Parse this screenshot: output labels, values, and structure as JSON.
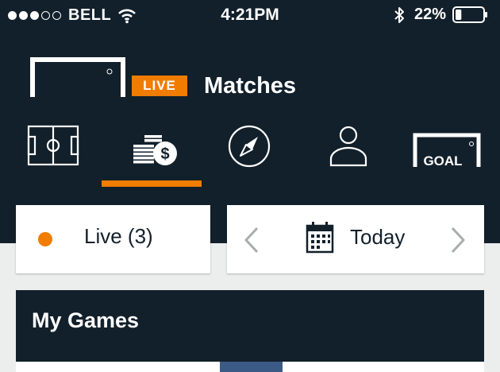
{
  "status_bar": {
    "carrier": "BELL",
    "time": "4:21PM",
    "battery_percent": "22%",
    "signal_bars_filled": 3,
    "signal_bars_total": 5,
    "battery_level": 0.22
  },
  "brand": {
    "live_badge": "LIVE",
    "title": "Matches",
    "logo_text": "GOAL"
  },
  "nav": {
    "items": [
      {
        "name": "pitch",
        "icon": "football-pitch-icon"
      },
      {
        "name": "betting",
        "icon": "coins-dollar-icon"
      },
      {
        "name": "explore",
        "icon": "compass-icon"
      },
      {
        "name": "profile",
        "icon": "user-icon"
      },
      {
        "name": "goal",
        "icon": "goal-logo-icon"
      }
    ],
    "active_index": 1
  },
  "filters": {
    "live_label": "Live (3)",
    "date_label": "Today"
  },
  "games": {
    "title": "My Games"
  },
  "colors": {
    "header_bg": "#12202b",
    "accent": "#f07c00",
    "page_bg": "#eceeee",
    "tab_blue": "#3c5a86"
  }
}
